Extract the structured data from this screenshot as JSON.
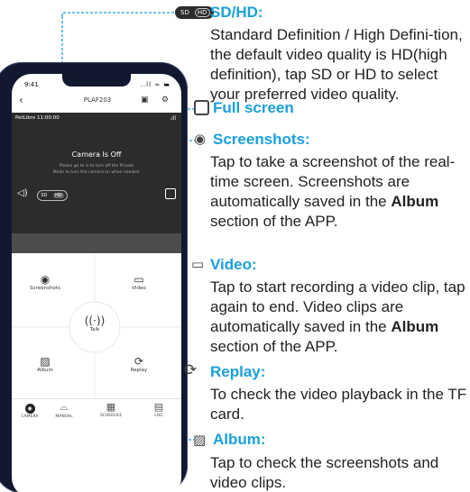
{
  "phone": {
    "status_time": "9:41",
    "status_icons": "..ll ≈ ▬",
    "header_title": "PLAF203",
    "video_overlay_text": "PetLibro 11:00:00",
    "camera_off_title": "Camera Is Off",
    "camera_off_line1": "Please go to ⊙ to turn off the Private",
    "camera_off_line2": "Mode to turn the camera on when needed.",
    "sd_label": "SD",
    "hd_label": "HD",
    "controls": {
      "screenshots": "Screenshots",
      "video": "Video",
      "talk": "Talk",
      "album": "Album",
      "replay": "Replay"
    },
    "tabs": {
      "camera": "CAMERA",
      "manual": "MANUAL",
      "schedule": "SCHEDULE",
      "log": "LOG"
    }
  },
  "annotations": {
    "sdhd_title": "SD/HD:",
    "sdhd_body": "Standard Definition / High Defini-tion, the default video quality is HD(high definition), tap SD or HD to select your preferred video quality.",
    "fullscreen_title": "Full screen",
    "screenshots_title": "Screenshots:",
    "screenshots_body_1": "Tap to take a screenshot of the real-time screen. Screenshots are automatically saved in the ",
    "screenshots_body_bold": "Album",
    "screenshots_body_2": " section of the APP.",
    "video_title": "Video:",
    "video_body_1": "Tap to start recording a video clip, tap again to end. Video clips are automatically saved in the ",
    "video_body_bold": "Album",
    "video_body_2": " section of the APP.",
    "replay_title": "Replay:",
    "replay_body": "To check the video playback in the TF card.",
    "album_title": "Album:",
    "album_body": "Tap to check the screenshots and video clips."
  },
  "colors": {
    "accent": "#1aa0dc",
    "phone_frame": "#12182f",
    "video_bg": "#2c2c2c"
  }
}
